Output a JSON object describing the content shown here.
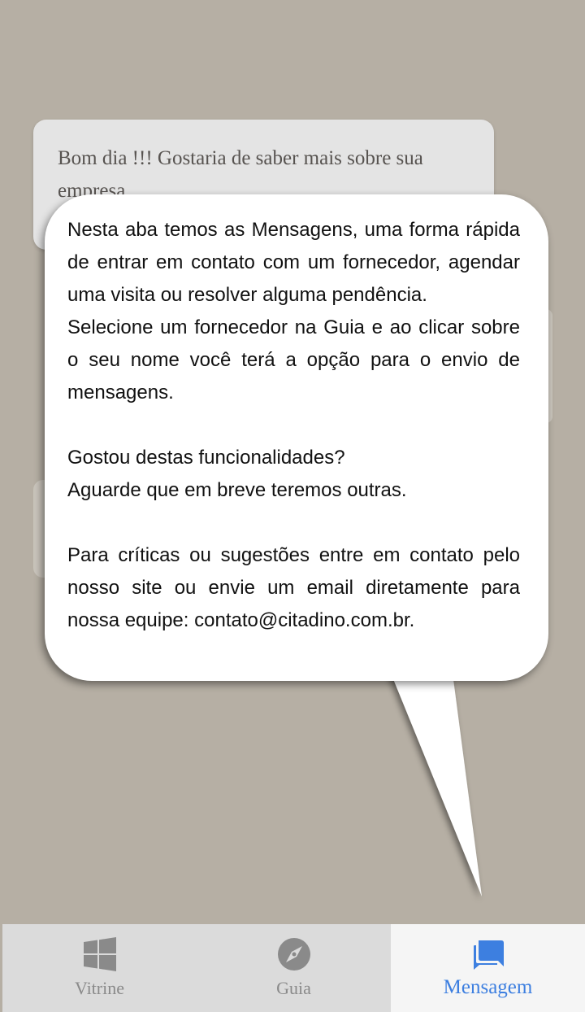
{
  "background_chat": {
    "message_text": "Bom dia !!! Gostaria de saber mais sobre sua empresa."
  },
  "tooltip": {
    "paragraph1": "Nesta aba temos as Mensagens, uma forma rápida de entrar em contato com um fornecedor, agendar uma visita ou resolver alguma pendência.",
    "paragraph2": "Selecione um fornecedor na Guia e ao clicar sobre o seu nome você terá a opção para o envio de mensagens.",
    "paragraph3_line1": "Gostou destas funcionalidades?",
    "paragraph3_line2": "Aguarde que em breve teremos outras.",
    "paragraph4": "Para críticas ou sugestões entre em contato pelo nosso site ou envie um email diretamente para nossa equipe: contato@citadino.com.br."
  },
  "bottom_nav": {
    "items": [
      {
        "label": "Vitrine",
        "icon": "windows-grid-icon",
        "active": false
      },
      {
        "label": "Guia",
        "icon": "compass-icon",
        "active": false
      },
      {
        "label": "Mensagem",
        "icon": "chat-messages-icon",
        "active": true
      }
    ],
    "active_color": "#3d7fe0",
    "inactive_color": "#8a8a8a"
  }
}
